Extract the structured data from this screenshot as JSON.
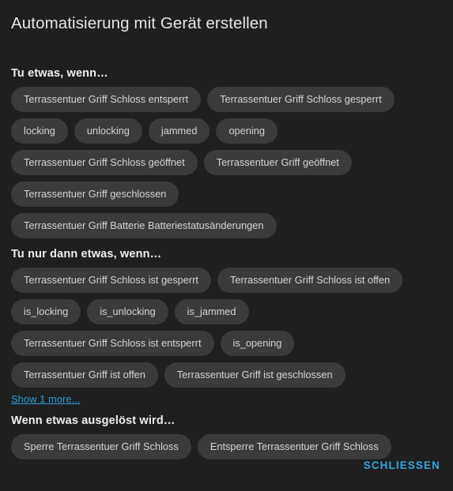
{
  "dialog": {
    "title": "Automatisierung mit Gerät erstellen",
    "close_label": "SCHLIESSEN"
  },
  "sections": [
    {
      "header": "Tu etwas, wenn…",
      "chips": [
        "Terrassentuer Griff Schloss entsperrt",
        "Terrassentuer Griff Schloss gesperrt",
        "locking",
        "unlocking",
        "jammed",
        "opening",
        "Terrassentuer Griff Schloss geöffnet",
        "Terrassentuer Griff geöffnet",
        "Terrassentuer Griff geschlossen",
        "Terrassentuer Griff Batterie Batteriestatusänderungen"
      ]
    },
    {
      "header": "Tu nur dann etwas, wenn…",
      "chips": [
        "Terrassentuer Griff Schloss ist gesperrt",
        "Terrassentuer Griff Schloss ist offen",
        "is_locking",
        "is_unlocking",
        "is_jammed",
        "Terrassentuer Griff Schloss ist entsperrt",
        "is_opening",
        "Terrassentuer Griff ist offen",
        "Terrassentuer Griff ist geschlossen"
      ],
      "show_more": "Show 1 more..."
    },
    {
      "header": "Wenn etwas ausgelöst wird…",
      "chips": [
        "Sperre Terrassentuer Griff Schloss",
        "Entsperre Terrassentuer Griff Schloss"
      ]
    }
  ],
  "colors": {
    "background": "#1f1f1f",
    "chip": "#3b3b3b",
    "accent": "#35a4dd",
    "link": "#2a9fd6",
    "text": "#e6e6e6"
  }
}
